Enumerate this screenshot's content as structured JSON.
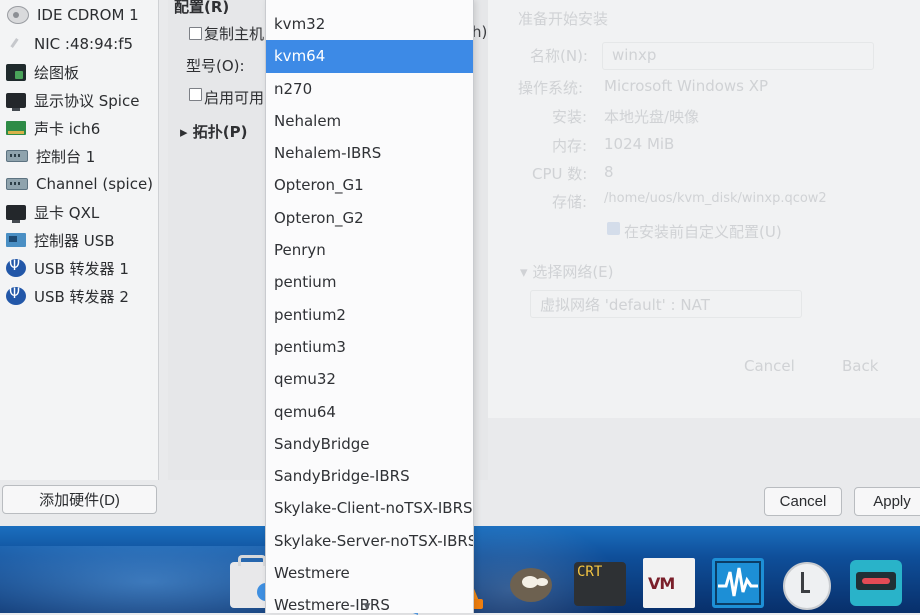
{
  "hardware_list": [
    {
      "label": "IDE CDROM 1",
      "icon": "cdrom-icon"
    },
    {
      "label": "NIC :48:94:f5",
      "icon": "network-icon"
    },
    {
      "label": "绘图板",
      "icon": "tablet-icon"
    },
    {
      "label": "显示协议 Spice",
      "icon": "display-icon"
    },
    {
      "label": "声卡 ich6",
      "icon": "sound-card-icon"
    },
    {
      "label": "控制台 1",
      "icon": "serial-icon"
    },
    {
      "label": "Channel (spice)",
      "icon": "serial-icon"
    },
    {
      "label": "显卡 QXL",
      "icon": "display-icon"
    },
    {
      "label": "控制器 USB",
      "icon": "usb-controller-icon"
    },
    {
      "label": "USB 转发器 1",
      "icon": "usb-icon"
    },
    {
      "label": "USB 转发器 2",
      "icon": "usb-icon"
    }
  ],
  "add_hardware_label": "添加硬件(D)",
  "config": {
    "section_label": "配置(R)",
    "copy_host_label": "复制主机",
    "copy_host_rest": "h)",
    "model_label": "型号(O):",
    "cpu_security_label": "启用可用的",
    "topology_label": "拓扑(P)"
  },
  "wizard": {
    "title": "准备开始安装",
    "name_label": "名称(N):",
    "name_value": "winxp",
    "os_label": "操作系统:",
    "os_value": "Microsoft Windows XP",
    "install_label": "安装:",
    "install_value": "本地光盘/映像",
    "memory_label": "内存:",
    "memory_value": "1024 MiB",
    "cpu_label": "CPU 数:",
    "cpu_value": "8",
    "storage_label": "存储:",
    "storage_value": "/home/uos/kvm_disk/winxp.qcow2",
    "customize_label": "在安装前自定义配置(U)",
    "network_section": "选择网络(E)",
    "network_value": "虚拟网络 'default' : NAT",
    "cancel_label": "Cancel",
    "back_label": "Back"
  },
  "dialog_buttons": {
    "cancel": "Cancel",
    "apply": "Apply"
  },
  "cpu_models": {
    "selected": "kvm64",
    "options": [
      "kvm32",
      "kvm64",
      "n270",
      "Nehalem",
      "Nehalem-IBRS",
      "Opteron_G1",
      "Opteron_G2",
      "Penryn",
      "pentium",
      "pentium2",
      "pentium3",
      "qemu32",
      "qemu64",
      "SandyBridge",
      "SandyBridge-IBRS",
      "Skylake-Client-noTSX-IBRS",
      "Skylake-Server-noTSX-IBRS",
      "Westmere",
      "Westmere-IBRS"
    ]
  },
  "taskbar": {
    "crt_label": "CRT",
    "vm_label": "VM",
    "apps": [
      "briefcase-icon",
      "vscode-icon",
      "vlc-icon",
      "gimp-icon",
      "crt-icon",
      "vm-icon",
      "waveform-icon",
      "timeshift-icon",
      "tape-icon"
    ]
  }
}
